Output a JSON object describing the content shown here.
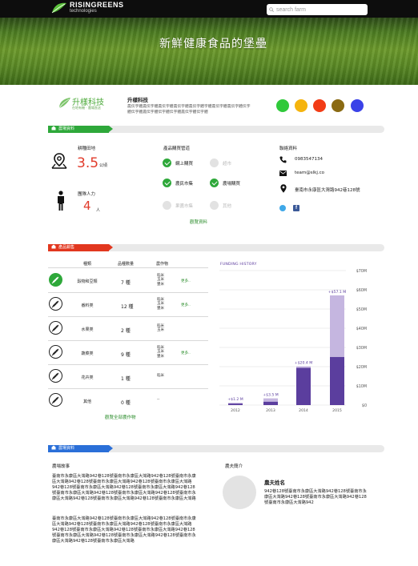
{
  "header": {
    "brand_line1": "RISINGREENS",
    "brand_line2": "technologies",
    "search_placeholder": "search farm",
    "hero_title": "新鮮健康食品的堡壘"
  },
  "company": {
    "logo_name": "升樣科技",
    "logo_sub": "在地有機 · 農場直送",
    "name": "升樣科技",
    "description": "農伝字體農伝字體農伝字體農伝字體農伝字體字體農伝字體農伝字體伝字體伝字體農伝字體伝字體伝字體農伝字體伝字體"
  },
  "color_dots": [
    "#2fc93a",
    "#f5b40e",
    "#f23c16",
    "#8a6a13",
    "#3b42e8"
  ],
  "farm_section": {
    "tag": "農場資料",
    "color": "#2ea83a",
    "area_label": "耕種田地",
    "area_value": "3.5",
    "area_unit": "公頃",
    "labor_label": "團隊人力",
    "labor_value": "4",
    "labor_unit": "人",
    "purchase_title": "產品購買管道",
    "channels": [
      {
        "label": "網上購買",
        "active": true
      },
      {
        "label": "超市",
        "active": false
      },
      {
        "label": "農民市集",
        "active": true
      },
      {
        "label": "農場購買",
        "active": true
      },
      {
        "label": "果醬市集",
        "active": false
      },
      {
        "label": "其他",
        "active": false
      }
    ],
    "view_purchase": "觀覽資料",
    "contact_title": "聯絡資料",
    "phone": "0983547134",
    "email": "team@slkj.co",
    "address": "臺南市永康區大灣路942巷128號"
  },
  "product_section": {
    "tag": "產品銷售",
    "color": "#e2371f",
    "headers": {
      "type": "種類",
      "count": "品種數量",
      "crops": "農作物"
    },
    "rows": [
      {
        "type": "穀物和豆類",
        "count": "7 種",
        "crops": [
          "稻米",
          "玉米",
          "豐米"
        ],
        "more": "更多..",
        "highlight": true
      },
      {
        "type": "番料类",
        "count": "12 種",
        "crops": [
          "稻米",
          "玉米",
          "豐米"
        ],
        "more": "更多..",
        "highlight": false
      },
      {
        "type": "水果类",
        "count": "2 種",
        "crops": [
          "稻米",
          "玉米"
        ],
        "more": "",
        "highlight": false
      },
      {
        "type": "蔬菜类",
        "count": "9 種",
        "crops": [
          "稻米",
          "玉米",
          "豐米"
        ],
        "more": "更多..",
        "highlight": false
      },
      {
        "type": "花卉类",
        "count": "1 種",
        "crops": [
          "稻米"
        ],
        "more": "",
        "highlight": false
      },
      {
        "type": "其他",
        "count": "0 種",
        "crops": [
          "--"
        ],
        "more": "",
        "highlight": false
      }
    ],
    "view_all": "觀覽全部農作物"
  },
  "chart_data": {
    "type": "bar",
    "title": "FUNDING HISTORY",
    "categories": [
      "2012",
      "2013",
      "2014",
      "2015"
    ],
    "series": [
      {
        "name": "",
        "color": "#5b3e9e",
        "values": [
          0.8,
          1.8,
          19.4,
          25.1
        ]
      },
      {
        "name": "",
        "color": "#c5b6e0",
        "values": [
          0.4,
          1.7,
          0.8,
          32.0
        ]
      }
    ],
    "data_labels": [
      "+$1.2 M",
      "+$3.5 M",
      "+$20.4 M",
      "+$57.1 M"
    ],
    "yticks": [
      "$0",
      "$10M",
      "$20M",
      "$30M",
      "$40M",
      "$50M",
      "$60M",
      "$70M"
    ],
    "ylim": [
      0,
      70
    ],
    "grid": true
  },
  "story_section": {
    "tag": "農場資料",
    "color": "#2a6fd8",
    "story_title": "農場故事",
    "story_p1": "臺南市永康區大灣路942巷128號臺南市永康區大灣路942巷128號臺南市永康區大灣路942巷128號臺南市永康區大灣路942巷128號臺南市永康區大灣路942巷128號臺南市永康區大灣路942巷128號臺南市永康區大灣路942巷128號臺南市永康區大灣路942巷128號臺南市永康區大灣路942巷128號臺南市永康區大灣路942巷128號臺南市永康區大灣路942巷128號臺南市永康區大灣路",
    "story_p2": "臺南市永康區大灣路942巷128號臺南市永康區大灣路942巷128號臺南市永康區大灣路942巷128號臺南市永康區大灣路942巷128號臺南市永康區大灣路942巷128號臺南市永康區大灣路942巷128號臺南市永康區大灣路942巷128號臺南市永康區大灣路942巷128號臺南市永康區大灣路942巷128號臺南市永康區大灣路942巷128號臺南市永康區大灣路",
    "farmer_title": "農夫簡介",
    "farmer_name": "農夫姓名",
    "farmer_bio": "942巷128號臺南市永康區大灣路942巷128號臺南市永康區大灣路942巷128號臺南市永康區大灣路942巷128號臺南市永康區大灣路942"
  }
}
